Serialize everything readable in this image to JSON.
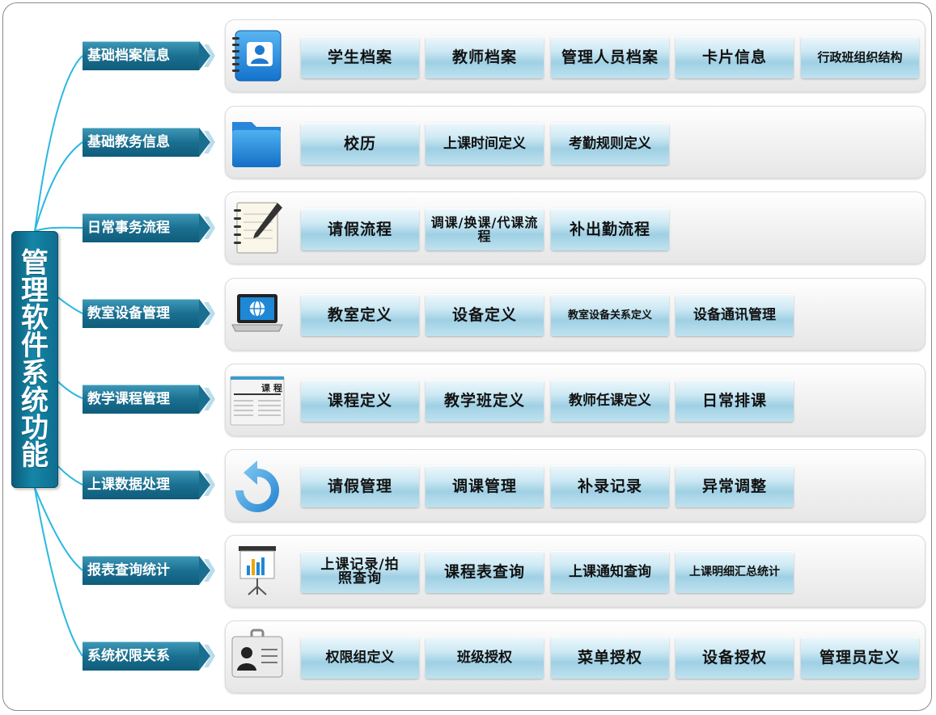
{
  "root": {
    "label": "管理软件系统功能"
  },
  "rows": [
    {
      "category": "基础档案信息",
      "icon": "contacts-book-icon",
      "buttons": [
        "学生档案",
        "教师档案",
        "管理人员档案",
        "卡片信息",
        "行政班组织结构"
      ]
    },
    {
      "category": "基础教务信息",
      "icon": "folder-icon",
      "buttons": [
        "校历",
        "上课时间定义",
        "考勤规则定义"
      ]
    },
    {
      "category": "日常事务流程",
      "icon": "notepad-pen-icon",
      "buttons": [
        "请假流程",
        "调课/换课/代课流程",
        "补出勤流程"
      ]
    },
    {
      "category": "教室设备管理",
      "icon": "laptop-globe-icon",
      "buttons": [
        "教室定义",
        "设备定义",
        "教室设备关系定义",
        "设备通讯管理"
      ]
    },
    {
      "category": "教学课程管理",
      "icon": "schedule-document-icon",
      "icon_text": "课 程",
      "buttons": [
        "课程定义",
        "教学班定义",
        "教师任课定义",
        "日常排课"
      ]
    },
    {
      "category": "上课数据处理",
      "icon": "refresh-arrow-icon",
      "buttons": [
        "请假管理",
        "调课管理",
        "补录记录",
        "异常调整"
      ]
    },
    {
      "category": "报表查询统计",
      "icon": "bar-chart-board-icon",
      "buttons": [
        "上课记录/拍照查询",
        "课程表查询",
        "上课通知查询",
        "上课明细汇总统计"
      ]
    },
    {
      "category": "系统权限关系",
      "icon": "id-badge-icon",
      "buttons": [
        "权限组定义",
        "班级授权",
        "菜单授权",
        "设备授权",
        "管理员定义"
      ]
    }
  ],
  "colors": {
    "category_bg": "#1a6f90",
    "root_bg": "#1586a8",
    "button_bg": "#cde9f4"
  }
}
